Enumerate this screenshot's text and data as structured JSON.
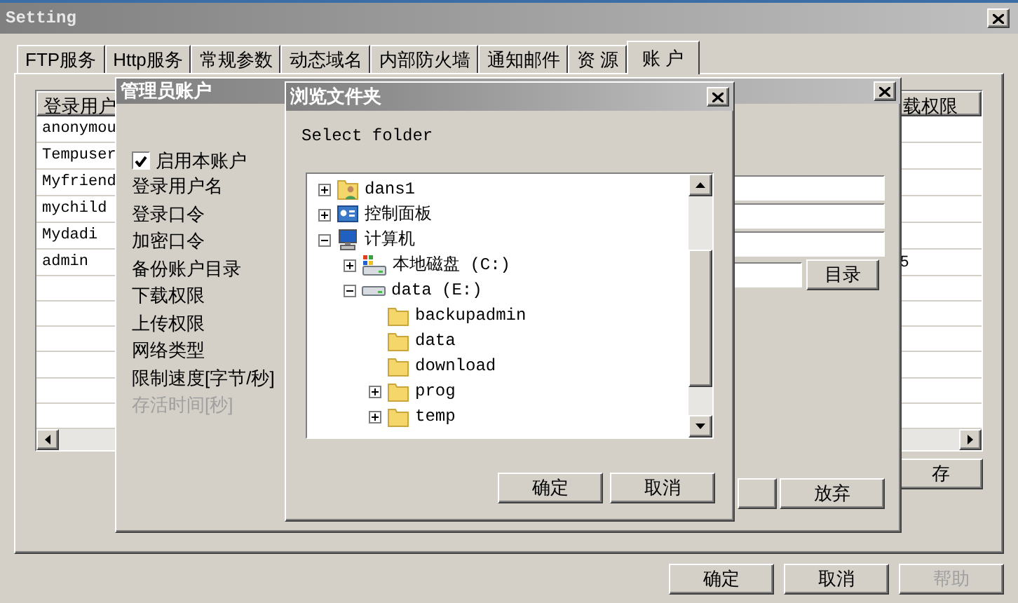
{
  "window": {
    "title": "Setting"
  },
  "tabs": [
    {
      "label": "FTP服务",
      "selected": false
    },
    {
      "label": "Http服务",
      "selected": false
    },
    {
      "label": "常规参数",
      "selected": false
    },
    {
      "label": "动态域名",
      "selected": false
    },
    {
      "label": "内部防火墙",
      "selected": false
    },
    {
      "label": "通知邮件",
      "selected": false
    },
    {
      "label": "资 源",
      "selected": false
    },
    {
      "label": "账 户",
      "selected": true
    }
  ],
  "user_list": {
    "column_1": "登录用户",
    "column_2": "载权限",
    "rows": [
      {
        "user": "anonymou"
      },
      {
        "user": "Tempuser"
      },
      {
        "user": "Myfriend"
      },
      {
        "user": "mychild"
      },
      {
        "user": "Mydadi"
      },
      {
        "user": "admin",
        "column_2": "5"
      }
    ],
    "save_button": "存"
  },
  "admin_dialog": {
    "title": "管理员账户",
    "enable": {
      "label": "启用本账户",
      "checked": true
    },
    "labels": [
      {
        "label": "登录用户名",
        "disabled": false
      },
      {
        "label": "登录口令",
        "disabled": false
      },
      {
        "label": "加密口令",
        "disabled": false
      },
      {
        "label": "备份账户目录",
        "disabled": false
      },
      {
        "label": "下载权限",
        "disabled": false
      },
      {
        "label": "上传权限",
        "disabled": false
      },
      {
        "label": "网络类型",
        "disabled": false
      },
      {
        "label": "限制速度[字节/秒]",
        "disabled": false
      },
      {
        "label": "存活时间[秒]",
        "disabled": true
      }
    ],
    "directory_button": "目录",
    "cancel_button": "放弃"
  },
  "browse_dialog": {
    "title": "浏览文件夹",
    "prompt": "Select folder",
    "tree": [
      {
        "label": "dans1",
        "kind": "user-folder",
        "expandable": true,
        "expanded": false
      },
      {
        "label": "控制面板",
        "kind": "control-panel",
        "expandable": true,
        "expanded": false
      },
      {
        "label": "计算机",
        "kind": "computer",
        "expandable": true,
        "expanded": true,
        "children": [
          {
            "label": "本地磁盘 (C:)",
            "kind": "system-drive",
            "expandable": true,
            "expanded": false
          },
          {
            "label": "data (E:)",
            "kind": "drive",
            "expandable": true,
            "expanded": true,
            "children": [
              {
                "label": "backupadmin",
                "kind": "folder",
                "expandable": false
              },
              {
                "label": "data",
                "kind": "folder",
                "expandable": false
              },
              {
                "label": "download",
                "kind": "folder",
                "expandable": false
              },
              {
                "label": "prog",
                "kind": "folder",
                "expandable": true,
                "expanded": false
              },
              {
                "label": "temp",
                "kind": "folder",
                "expandable": true,
                "expanded": false
              }
            ]
          }
        ]
      }
    ],
    "buttons": [
      "确定",
      "取消"
    ]
  },
  "buttons": [
    {
      "label": "确定",
      "disabled": false
    },
    {
      "label": "取消",
      "disabled": false
    },
    {
      "label": "帮助",
      "disabled": true
    }
  ]
}
